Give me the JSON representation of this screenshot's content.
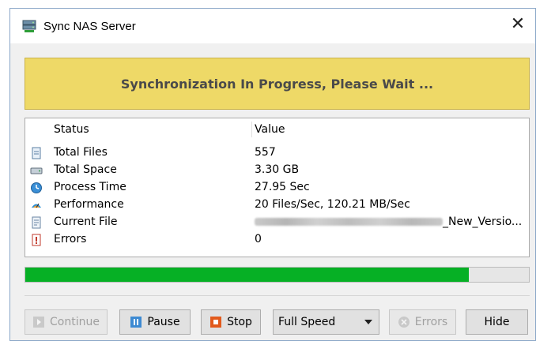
{
  "window": {
    "title": "Sync NAS Server",
    "close_glyph": "✕"
  },
  "banner": {
    "text": "Synchronization In Progress, Please Wait ..."
  },
  "table": {
    "headers": {
      "status": "Status",
      "value": "Value"
    },
    "rows": [
      {
        "icon": "file-icon",
        "status": "Total Files",
        "value": "557"
      },
      {
        "icon": "drive-icon",
        "status": "Total Space",
        "value": "3.30 GB"
      },
      {
        "icon": "clock-icon",
        "status": "Process Time",
        "value": "27.95 Sec"
      },
      {
        "icon": "performance-icon",
        "status": "Performance",
        "value": "20 Files/Sec, 120.21 MB/Sec"
      },
      {
        "icon": "current-file-icon",
        "status": "Current File",
        "value": "_New_Versio..."
      },
      {
        "icon": "error-icon",
        "status": "Errors",
        "value": "0"
      }
    ]
  },
  "progress": {
    "percent": 88
  },
  "buttons": {
    "continue": "Continue",
    "pause": "Pause",
    "stop": "Stop",
    "speed": "Full Speed",
    "errors": "Errors",
    "hide": "Hide"
  },
  "colors": {
    "banner": "#eed967",
    "progress": "#06b025"
  }
}
